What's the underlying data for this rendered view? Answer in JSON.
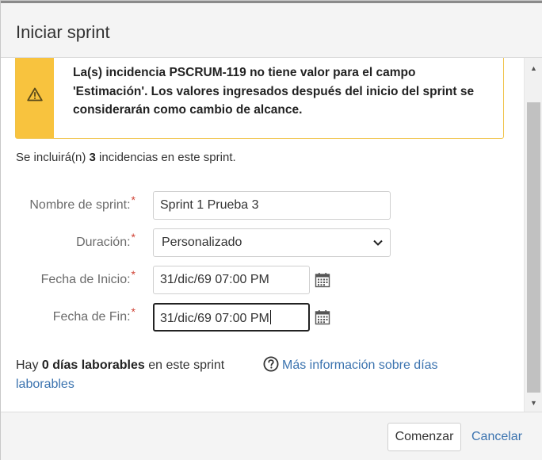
{
  "dialog": {
    "title": "Iniciar sprint"
  },
  "warning": {
    "icon": "warning-triangle-icon",
    "message": "La(s) incidencia PSCRUM-119 no tiene valor para el campo 'Estimación'. Los valores ingresados después del inicio del sprint se considerarán como cambio de alcance."
  },
  "summary": {
    "prefix": "Se incluirá(n) ",
    "count": "3",
    "suffix": " incidencias en este sprint."
  },
  "form": {
    "required_mark": "*",
    "sprint_name": {
      "label": "Nombre de sprint:",
      "value": "Sprint 1 Prueba 3"
    },
    "duration": {
      "label": "Duración:",
      "value": "Personalizado"
    },
    "start_date": {
      "label": "Fecha de Inicio:",
      "value": "31/dic/69 07:00 PM"
    },
    "end_date": {
      "label": "Fecha de Fin:",
      "value": "31/dic/69 07:00 PM"
    }
  },
  "workdays": {
    "prefix": "Hay ",
    "bold": "0 días laborables",
    "suffix": " en este sprint",
    "help_link_1": "Más información sobre días",
    "help_link_2": "laborables"
  },
  "footer": {
    "start_button": "Comenzar",
    "cancel_link": "Cancelar"
  },
  "colors": {
    "warning_accent": "#f8c33e",
    "link": "#3b73af",
    "required": "#d04437"
  }
}
